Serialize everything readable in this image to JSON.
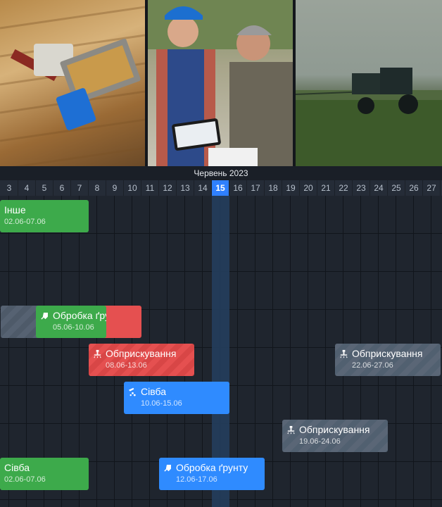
{
  "month_label": "Червень 2023",
  "days": [
    "3",
    "4",
    "5",
    "6",
    "7",
    "8",
    "9",
    "10",
    "11",
    "12",
    "13",
    "14",
    "15",
    "16",
    "17",
    "18",
    "19",
    "20",
    "21",
    "22",
    "23",
    "24",
    "25",
    "26",
    "27"
  ],
  "today": "15",
  "events": [
    {
      "title": "Інше",
      "dates": "02.06-07.06",
      "icon": "none"
    },
    {
      "title": "Обробка ґрунту",
      "dates": "05.06-10.06",
      "icon": "soil-icon"
    },
    {
      "title": "Обприскування",
      "dates": "08.06-13.06",
      "icon": "sprayer-icon"
    },
    {
      "title": "Обприскування",
      "dates": "22.06-27.06",
      "icon": "sprayer-icon"
    },
    {
      "title": "Сівба",
      "dates": "10.06-15.06",
      "icon": "seeding-icon"
    },
    {
      "title": "Обприскування",
      "dates": "19.06-24.06",
      "icon": "sprayer-icon"
    },
    {
      "title": "Сівба",
      "dates": "02.06-07.06",
      "icon": "none"
    },
    {
      "title": "Обробка ґрунту",
      "dates": "12.06-17.06",
      "icon": "soil-icon"
    }
  ],
  "colors": {
    "green": "#3daa4b",
    "red": "#e55050",
    "blue": "#2f8bff",
    "gray": "#5a6676",
    "today": "#2f80ff"
  }
}
